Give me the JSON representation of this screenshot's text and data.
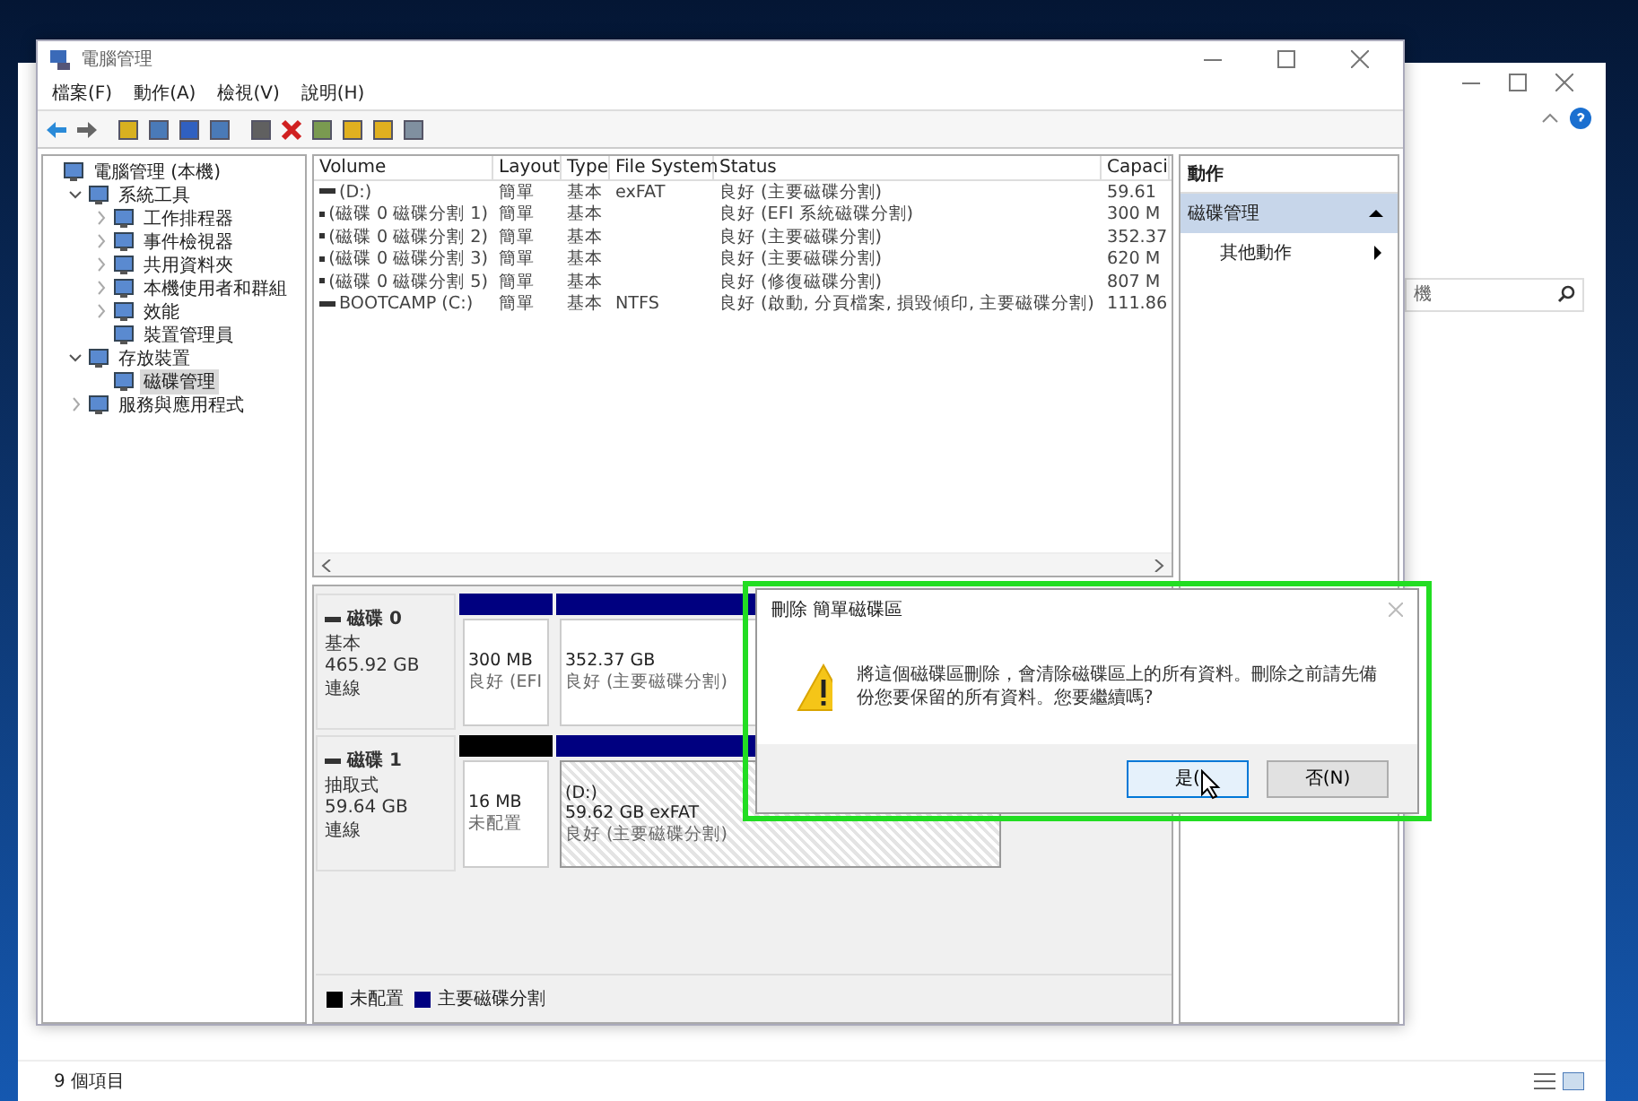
{
  "back_window": {
    "search": {
      "placeholder": "機"
    },
    "status_bar": "9 個項目"
  },
  "window": {
    "title": "電腦管理"
  },
  "menu": [
    "檔案(F)",
    "動作(A)",
    "檢視(V)",
    "說明(H)"
  ],
  "tree": [
    {
      "label": "電腦管理 (本機)",
      "selected": false,
      "children": [
        {
          "label": "系統工具",
          "expanded": true,
          "selected": false,
          "children": [
            {
              "label": "工作排程器",
              "expanded": false,
              "selected": false
            },
            {
              "label": "事件檢視器",
              "expanded": false,
              "selected": false
            },
            {
              "label": "共用資料夾",
              "expanded": false,
              "selected": false
            },
            {
              "label": "本機使用者和群組",
              "expanded": false,
              "selected": false
            },
            {
              "label": "效能",
              "expanded": false,
              "selected": false
            },
            {
              "label": "裝置管理員",
              "selected": false
            }
          ]
        },
        {
          "label": "存放裝置",
          "expanded": true,
          "selected": false,
          "children": [
            {
              "label": "磁碟管理",
              "selected": true
            }
          ]
        },
        {
          "label": "服務與應用程式",
          "expanded": false,
          "selected": false
        }
      ]
    }
  ],
  "table": {
    "columns": [
      "Volume",
      "Layout",
      "Type",
      "File System",
      "Status",
      "Capaci"
    ],
    "rows": [
      [
        "(D:)",
        "簡單",
        "基本",
        "exFAT",
        "良好 (主要磁碟分割)",
        "59.61"
      ],
      [
        "(磁碟 0 磁碟分割 1)",
        "簡單",
        "基本",
        "",
        "良好 (EFI 系統磁碟分割)",
        "300 M"
      ],
      [
        "(磁碟 0 磁碟分割 2)",
        "簡單",
        "基本",
        "",
        "良好 (主要磁碟分割)",
        "352.37"
      ],
      [
        "(磁碟 0 磁碟分割 3)",
        "簡單",
        "基本",
        "",
        "良好 (主要磁碟分割)",
        "620 M"
      ],
      [
        "(磁碟 0 磁碟分割 5)",
        "簡單",
        "基本",
        "",
        "良好 (修復磁碟分割)",
        "807 M"
      ],
      [
        "BOOTCAMP (C:)",
        "簡單",
        "基本",
        "NTFS",
        "良好 (啟動, 分頁檔案, 損毀傾印, 主要磁碟分割)",
        "111.86"
      ]
    ]
  },
  "disks": [
    {
      "name": "磁碟 0",
      "type": "基本",
      "size": "465.92 GB",
      "state": "連線",
      "partitions": [
        {
          "size": "300 MB",
          "status": "良好 (EFI",
          "color": "#000080",
          "selected": false
        },
        {
          "size": "352.37 GB",
          "status": "良好 (主要磁碟分割)",
          "color": "#000080",
          "selected": false
        }
      ]
    },
    {
      "name": "磁碟 1",
      "type": "抽取式",
      "size": "59.64 GB",
      "state": "連線",
      "partitions": [
        {
          "size": "16 MB",
          "status": "未配置",
          "color": "#000000",
          "selected": false
        },
        {
          "name": "(D:)",
          "size": "59.62 GB exFAT",
          "status": "良好 (主要磁碟分割)",
          "color": "#000080",
          "selected": true
        }
      ]
    }
  ],
  "legend": [
    {
      "label": "未配置",
      "color": "#000000"
    },
    {
      "label": "主要磁碟分割",
      "color": "#000080"
    }
  ],
  "actions": {
    "header": "動作",
    "items": [
      {
        "label": "磁碟管理",
        "kind": "section",
        "selected": true
      },
      {
        "label": "其他動作",
        "kind": "submenu",
        "selected": false
      }
    ]
  },
  "dialog": {
    "title": "刪除 簡單磁碟區",
    "message": "將這個磁碟區刪除，會清除磁碟區上的所有資料。刪除之前請先備份您要保留的所有資料。您要繼續嗎?",
    "buttons": [
      {
        "label": "是(",
        "selected": true
      },
      {
        "label": "否(N)",
        "selected": false
      }
    ]
  }
}
